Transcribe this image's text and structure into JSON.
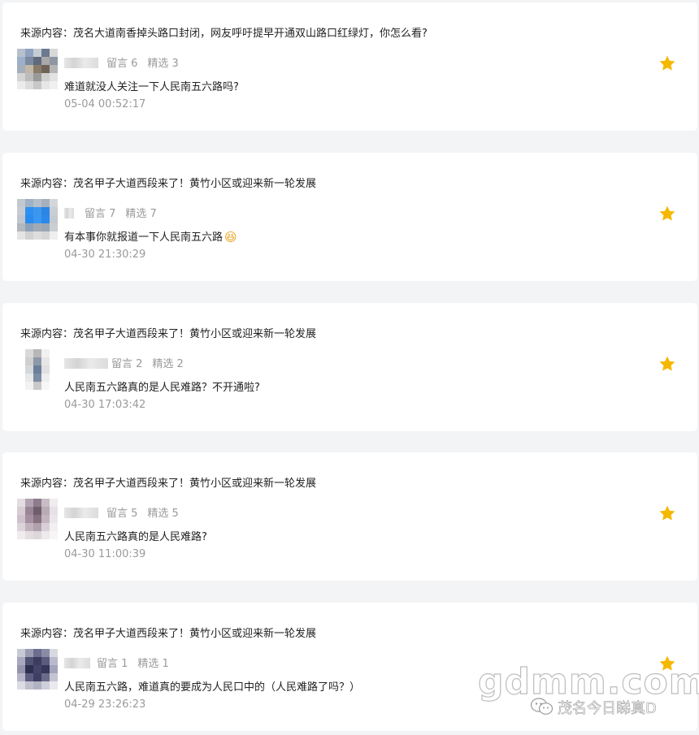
{
  "comments": [
    {
      "source_label": "来源内容：",
      "source_title": "茂名大道南香掉头路口封闭，网友呼吁提早开通双山路口红绿灯，你怎么看?",
      "stats_reply": "留言 6",
      "stats_selected": "精选 3",
      "text": "难道就没人关注一下人民南五六路吗?",
      "emoji": "",
      "time": "05-04 00:52:17"
    },
    {
      "source_label": "来源内容：",
      "source_title": "茂名甲子大道西段来了！黄竹小区或迎来新一轮发展",
      "stats_reply": "留言 7",
      "stats_selected": "精选 7",
      "text": "有本事你就报道一下人民南五六路",
      "emoji": "😆",
      "time": "04-30 21:30:29"
    },
    {
      "source_label": "来源内容：",
      "source_title": "茂名甲子大道西段来了！黄竹小区或迎来新一轮发展",
      "stats_reply": "留言 2",
      "stats_selected": "精选 2",
      "text": "人民南五六路真的是人民难路？不开通啦?",
      "emoji": "",
      "time": "04-30 17:03:42"
    },
    {
      "source_label": "来源内容：",
      "source_title": "茂名甲子大道西段来了！黄竹小区或迎来新一轮发展",
      "stats_reply": "留言 5",
      "stats_selected": "精选 5",
      "text": "人民南五六路真的是人民难路?",
      "emoji": "",
      "time": "04-30 11:00:39"
    },
    {
      "source_label": "来源内容：",
      "source_title": "茂名甲子大道西段来了！黄竹小区或迎来新一轮发展",
      "stats_reply": "留言 1",
      "stats_selected": "精选 1",
      "text": "人民南五六路，难道真的要成为人民口中的（人民难路了吗？）",
      "emoji": "",
      "time": "04-29 23:26:23"
    }
  ],
  "watermark": {
    "domain": "gdmm.com",
    "account": "茂名今日睇真D"
  },
  "colors": {
    "page_bg": "#f3f4f6",
    "card_bg": "#ffffff",
    "text_primary": "#222222",
    "text_secondary": "#9a9a9a",
    "star": "#f5b800"
  },
  "icons": {
    "star": "star-icon",
    "watermark_logo": "wechat-logo-icon"
  }
}
